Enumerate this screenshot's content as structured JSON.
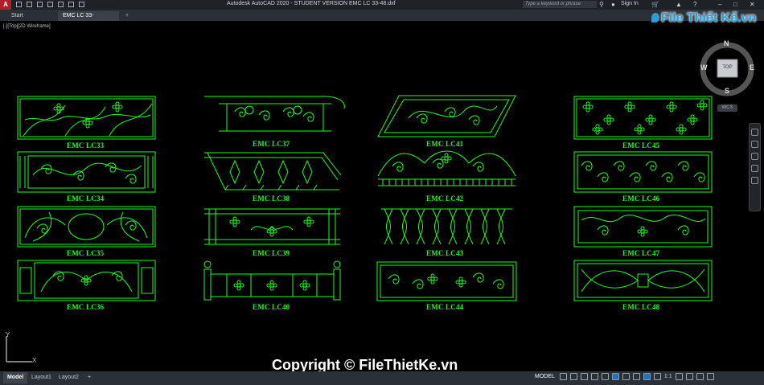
{
  "app": {
    "title": "Autodesk AutoCAD 2020 - STUDENT VERSION    EMC LC 33-48.dxf",
    "logo_letter": "A",
    "search_placeholder": "Type a keyword or phrase",
    "sign_in": "Sign In",
    "help": "?"
  },
  "tabs": [
    {
      "label": "Start"
    },
    {
      "label": "EMC LC 33-48.dxf*"
    }
  ],
  "tab_add": "+",
  "viewport_label": "[-][Top][2D Wireframe]",
  "viewcube": {
    "top": "TOP",
    "n": "N",
    "s": "S",
    "e": "E",
    "w": "W",
    "wcs": "WCS"
  },
  "watermark_logo": "File Thiết Kế.vn",
  "ucs": {
    "x": "X",
    "y": "Y"
  },
  "panels": [
    {
      "id": "lc33",
      "label": "EMC LC33"
    },
    {
      "id": "lc34",
      "label": "EMC LC34"
    },
    {
      "id": "lc35",
      "label": "EMC LC35"
    },
    {
      "id": "lc36",
      "label": "EMC LC36"
    },
    {
      "id": "lc37",
      "label": "EMC LC37"
    },
    {
      "id": "lc38",
      "label": "EMC LC38"
    },
    {
      "id": "lc39",
      "label": "EMC LC39"
    },
    {
      "id": "lc40",
      "label": "EMC LC40"
    },
    {
      "id": "lc41",
      "label": "EMC LC41"
    },
    {
      "id": "lc42",
      "label": "EMC LC42"
    },
    {
      "id": "lc43",
      "label": "EMC LC43"
    },
    {
      "id": "lc44",
      "label": "EMC LC44"
    },
    {
      "id": "lc45",
      "label": "EMC LC45"
    },
    {
      "id": "lc46",
      "label": "EMC LC46"
    },
    {
      "id": "lc47",
      "label": "EMC LC47"
    },
    {
      "id": "lc48",
      "label": "EMC LC48"
    }
  ],
  "copyright": "Copyright © FileThietKe.vn",
  "layout_tabs": [
    {
      "label": "Model"
    },
    {
      "label": "Layout1"
    },
    {
      "label": "Layout2"
    }
  ],
  "layout_add": "+",
  "status": {
    "model": "MODEL",
    "scale": "1:1"
  },
  "colors": {
    "drawing": "#1aff1a",
    "background": "#000000",
    "chrome": "#2b2f36"
  }
}
